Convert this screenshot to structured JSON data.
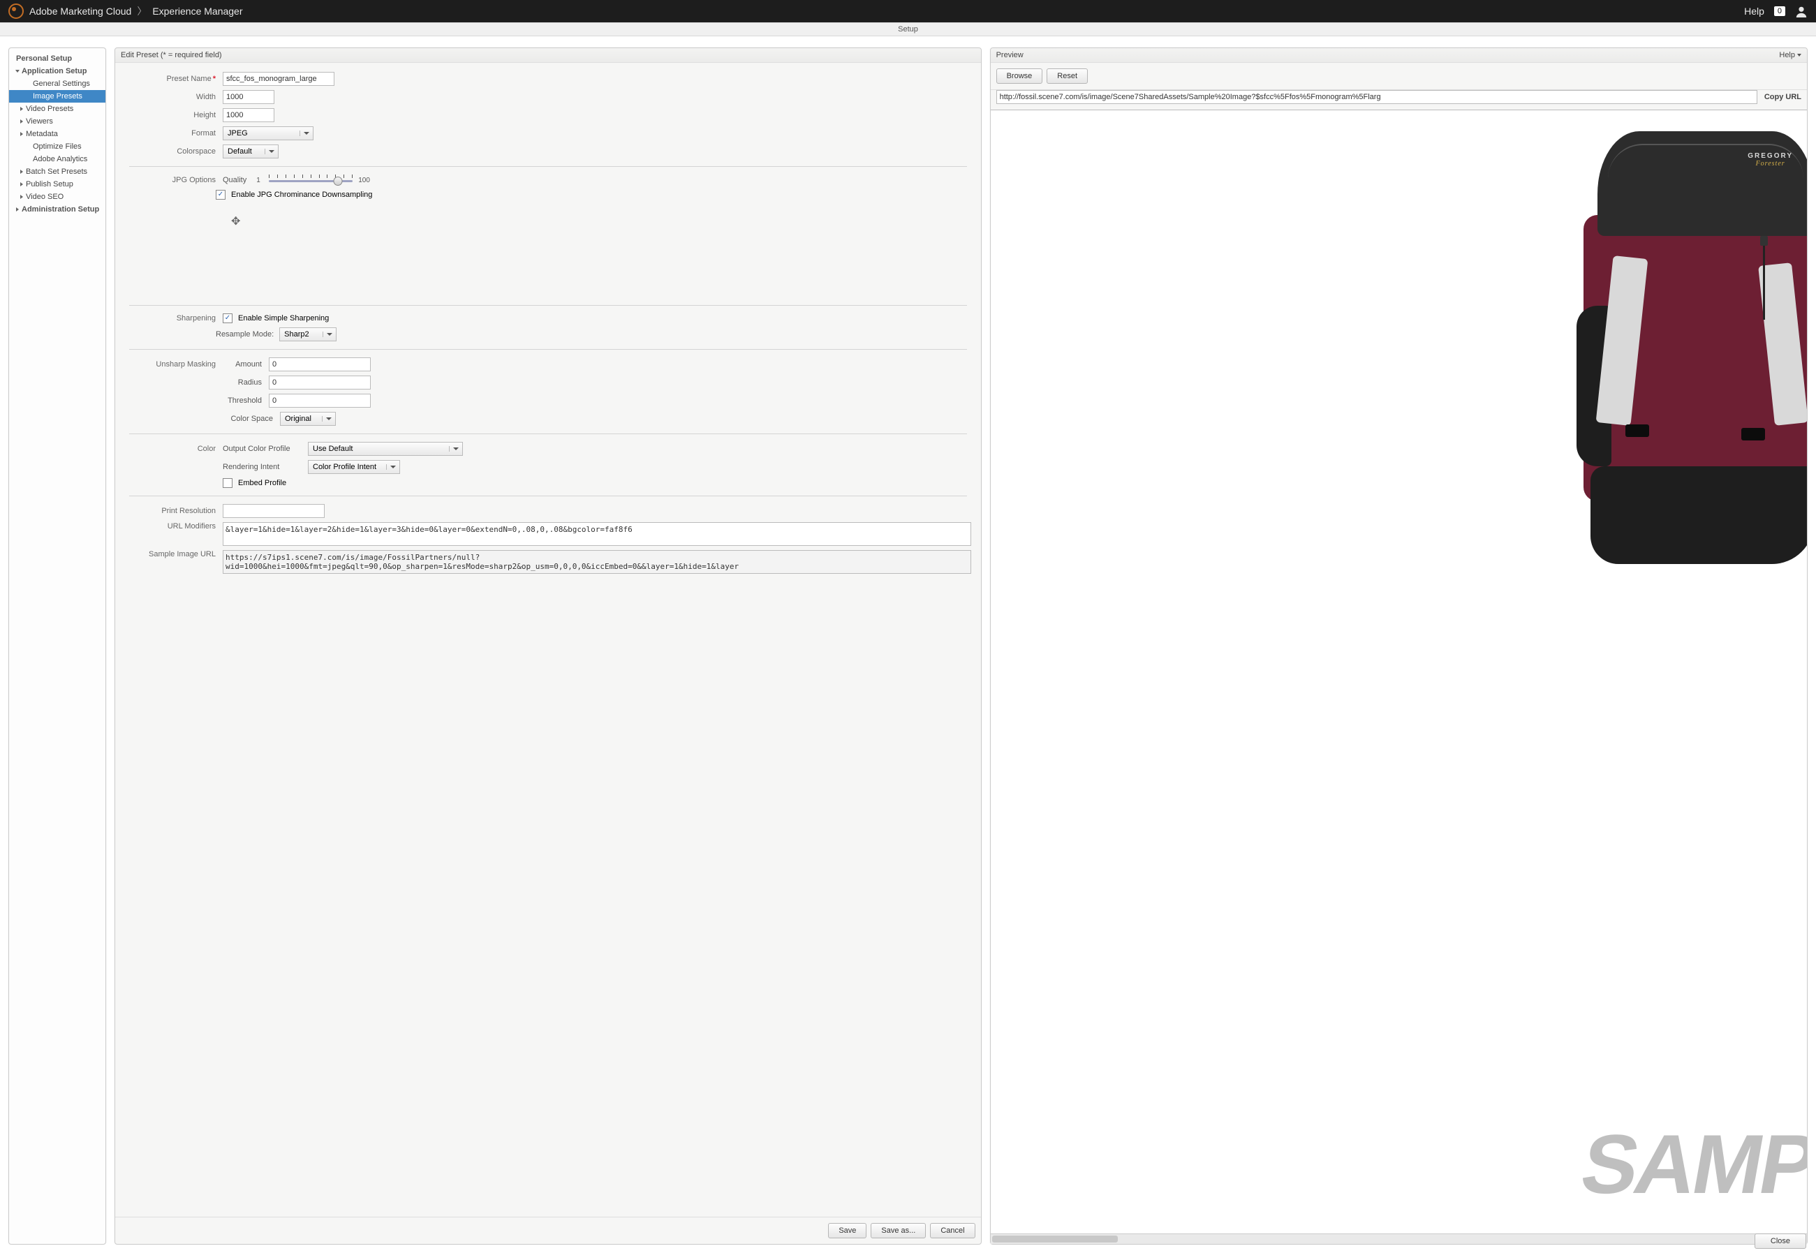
{
  "topbar": {
    "brand": "Adobe Marketing Cloud",
    "product": "Experience Manager",
    "help": "Help",
    "notif_count": "0"
  },
  "subheader": {
    "label": "Setup"
  },
  "sidebar": {
    "personal": "Personal Setup",
    "app_setup": "Application Setup",
    "general": "General Settings",
    "image_presets": "Image Presets",
    "video_presets": "Video Presets",
    "viewers": "Viewers",
    "metadata": "Metadata",
    "optimize": "Optimize Files",
    "analytics": "Adobe Analytics",
    "batch": "Batch Set Presets",
    "publish": "Publish Setup",
    "video_seo": "Video SEO",
    "admin": "Administration Setup"
  },
  "center": {
    "title": "Edit Preset (* = required field)",
    "labels": {
      "preset_name": "Preset Name",
      "width": "Width",
      "height": "Height",
      "format": "Format",
      "colorspace": "Colorspace",
      "jpg_options": "JPG Options",
      "quality": "Quality",
      "q_min": "1",
      "q_max": "100",
      "chroma": "Enable JPG Chrominance Downsampling",
      "sharpening": "Sharpening",
      "simple_sharp": "Enable Simple Sharpening",
      "resample": "Resample Mode:",
      "unsharp": "Unsharp Masking",
      "amount": "Amount",
      "radius": "Radius",
      "threshold": "Threshold",
      "color_space": "Color Space",
      "color": "Color",
      "ocp": "Output Color Profile",
      "ri": "Rendering Intent",
      "embed": "Embed Profile",
      "print_res": "Print Resolution",
      "url_mod": "URL Modifiers",
      "sample_url": "Sample Image URL"
    },
    "values": {
      "preset_name": "sfcc_fos_monogram_large",
      "width": "1000",
      "height": "1000",
      "format": "JPEG",
      "colorspace": "Default",
      "quality_pct": 82,
      "chroma_checked": true,
      "simple_sharp_checked": true,
      "resample": "Sharp2",
      "amount": "0",
      "radius": "0",
      "threshold": "0",
      "color_space": "Original",
      "ocp": "Use Default",
      "ri": "Color Profile Intent",
      "embed_checked": false,
      "print_res": "",
      "url_mod": "&layer=1&hide=1&layer=2&hide=1&layer=3&hide=0&layer=0&extendN=0,.08,0,.08&bgcolor=faf8f6",
      "sample_url": "https://s7ips1.scene7.com/is/image/FossilPartners/null?wid=1000&hei=1000&fmt=jpeg&qlt=90,0&op_sharpen=1&resMode=sharp2&op_usm=0,0,0,0&iccEmbed=0&&layer=1&hide=1&layer"
    },
    "buttons": {
      "save": "Save",
      "save_as": "Save as...",
      "cancel": "Cancel"
    }
  },
  "right": {
    "title": "Preview",
    "help": "Help",
    "browse": "Browse",
    "reset": "Reset",
    "copy": "Copy URL",
    "url": "http://fossil.scene7.com/is/image/Scene7SharedAssets/Sample%20Image?$sfcc%5Ffos%5Fmonogram%5Flarg",
    "brand": "GREGORY",
    "brand2": "Forester",
    "watermark": "SAMP"
  },
  "footer": {
    "close": "Close"
  }
}
